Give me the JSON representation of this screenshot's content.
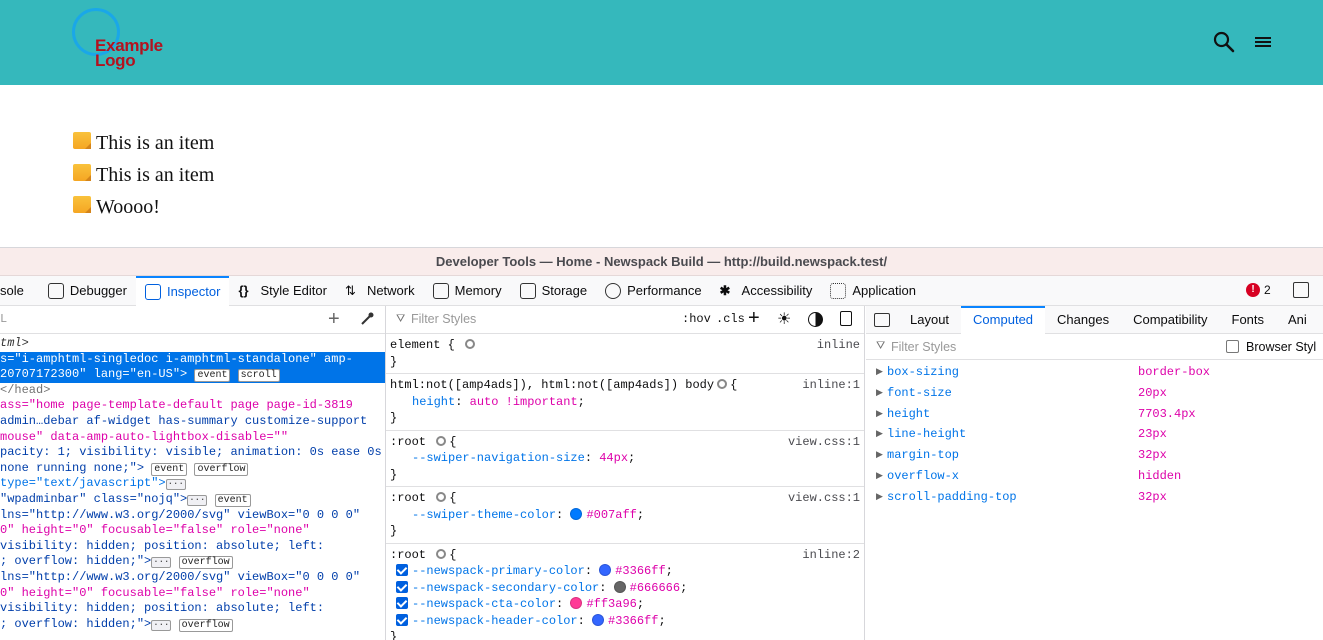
{
  "site": {
    "logo_line1": "Example",
    "logo_line2": "Logo",
    "items": [
      "This is an item",
      "This is an item",
      "Woooo!"
    ]
  },
  "devtools": {
    "window_title": "Developer Tools — Home - Newspack Build — http://build.newspack.test/",
    "tabs": [
      {
        "label": "sole",
        "icon": "console-icon"
      },
      {
        "label": "Debugger",
        "icon": "debugger-icon"
      },
      {
        "label": "Inspector",
        "icon": "inspector-icon"
      },
      {
        "label": "Style Editor",
        "icon": "style-editor-icon"
      },
      {
        "label": "Network",
        "icon": "network-icon"
      },
      {
        "label": "Memory",
        "icon": "memory-icon"
      },
      {
        "label": "Storage",
        "icon": "storage-icon"
      },
      {
        "label": "Performance",
        "icon": "performance-icon"
      },
      {
        "label": "Accessibility",
        "icon": "accessibility-icon"
      },
      {
        "label": "Application",
        "icon": "application-icon"
      }
    ],
    "error_count": "2",
    "markup": {
      "search_placeholder": "L",
      "lines": [
        "tml>",
        "s=\"i-amphtml-singledoc i-amphtml-standalone\" amp-",
        "20707172300\" lang=\"en-US\">",
        "</head>",
        "ass=\"home page-template-default page page-id-3819",
        "admin…debar af-widget has-summary customize-support",
        "mouse\" data-amp-auto-lightbox-disable=\"\"",
        "pacity: 1; visibility: visible; animation: 0s ease 0s",
        "none running none;\">",
        "type=\"text/javascript\">",
        "\"wpadminbar\" class=\"nojq\">",
        "lns=\"http://www.w3.org/2000/svg\" viewBox=\"0 0 0 0\"",
        "0\" height=\"0\" focusable=\"false\" role=\"none\"",
        "visibility: hidden; position: absolute; left:",
        "; overflow: hidden;\">",
        "lns=\"http://www.w3.org/2000/svg\" viewBox=\"0 0 0 0\"",
        "0\" height=\"0\" focusable=\"false\" role=\"none\"",
        "visibility: hidden; position: absolute; left:",
        "; overflow: hidden;\">"
      ],
      "badge_event": "event",
      "badge_scroll": "scroll",
      "badge_overflow": "overflow"
    },
    "rules": {
      "filter_placeholder": "Filter Styles",
      "hov": ":hov",
      "cls": ".cls",
      "blocks": [
        {
          "selector": "element {",
          "source": "inline",
          "decls": [],
          "close": "}"
        },
        {
          "selector": "html:not([amp4ads]), html:not([amp4ads]) body",
          "source": "inline:1",
          "decls": [
            {
              "p": "height",
              "v": "auto !important"
            }
          ],
          "close": "}"
        },
        {
          "selector": ":root",
          "source": "view.css:1",
          "decls": [
            {
              "p": "--swiper-navigation-size",
              "v": "44px"
            }
          ],
          "close": "}"
        },
        {
          "selector": ":root",
          "source": "view.css:1",
          "decls": [
            {
              "p": "--swiper-theme-color",
              "v": "#007aff",
              "color": "#007aff"
            }
          ],
          "close": "}"
        },
        {
          "selector": ":root",
          "source": "inline:2",
          "decls": [
            {
              "p": "--newspack-primary-color",
              "v": "#3366ff",
              "color": "#3366ff",
              "checked": true
            },
            {
              "p": "--newspack-secondary-color",
              "v": "#666666",
              "color": "#666666",
              "checked": true
            },
            {
              "p": "--newspack-cta-color",
              "v": "#ff3a96",
              "color": "#ff3a96",
              "checked": true
            },
            {
              "p": "--newspack-header-color",
              "v": "#3366ff",
              "color": "#3366ff",
              "checked": true
            }
          ],
          "close": "}"
        }
      ]
    },
    "side": {
      "tabs": [
        "Layout",
        "Computed",
        "Changes",
        "Compatibility",
        "Fonts",
        "Ani"
      ],
      "active_tab": "Computed",
      "filter_placeholder": "Filter Styles",
      "browser_styles_label": "Browser Styl",
      "computed": [
        {
          "name": "box-sizing",
          "value": "border-box"
        },
        {
          "name": "font-size",
          "value": "20px"
        },
        {
          "name": "height",
          "value": "7703.4px"
        },
        {
          "name": "line-height",
          "value": "23px"
        },
        {
          "name": "margin-top",
          "value": "32px"
        },
        {
          "name": "overflow-x",
          "value": "hidden"
        },
        {
          "name": "scroll-padding-top",
          "value": "32px"
        }
      ]
    }
  }
}
